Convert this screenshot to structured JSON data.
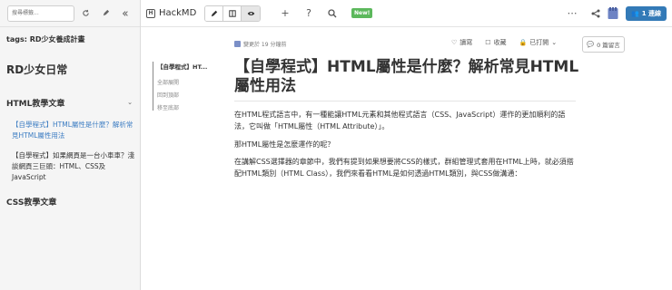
{
  "sidebar": {
    "search_placeholder": "搜尋標籤...",
    "tags": "tags: RD少女養成計畫",
    "heading1": "RD少女日常",
    "section1": "HTML教學文章",
    "items": [
      {
        "label": "【自學程式】HTML屬性是什麼？解析常見HTML屬性用法",
        "active": true
      },
      {
        "label": "【自學程式】如果網頁是一台小車車？淺談網頁三巨頭：HTML、CSS及JavaScript",
        "active": false
      }
    ],
    "section2": "CSS教學文章"
  },
  "topbar": {
    "brand": "HackMD",
    "new_badge": "New!",
    "online_label": "1 連線"
  },
  "toc": {
    "active": "【自學程式】HT...",
    "links": [
      "全部展開",
      "回到頂部",
      "移至底部"
    ]
  },
  "doc": {
    "meta": "變更於 19 分鐘前",
    "actions": {
      "read": "讀寫",
      "bookmark": "收藏",
      "published": "已打開",
      "comment": "0 篇留言"
    },
    "title": "【自學程式】HTML屬性是什麼？解析常見HTML屬性用法",
    "paragraphs": [
      "在HTML程式語言中，有一種能讓HTML元素和其他程式語言（CSS、JavaScript）運作的更加順利的語法，它叫做「HTML屬性（HTML Attribute）」。",
      "那HTML屬性是怎麼運作的呢？",
      "在講解CSS選擇器的章節中，我們有提到如果想要將CSS的樣式，群組管理式套用在HTML上時，就必須搭配HTML類別（HTML Class），我們來看看HTML是如何透過HTML類別，與CSS做溝通："
    ]
  },
  "colors": {
    "accent": "#337ab7",
    "link": "#3b7cc2",
    "new_badge": "#5cb85c",
    "sidebar_bg": "#f5f5f5"
  }
}
